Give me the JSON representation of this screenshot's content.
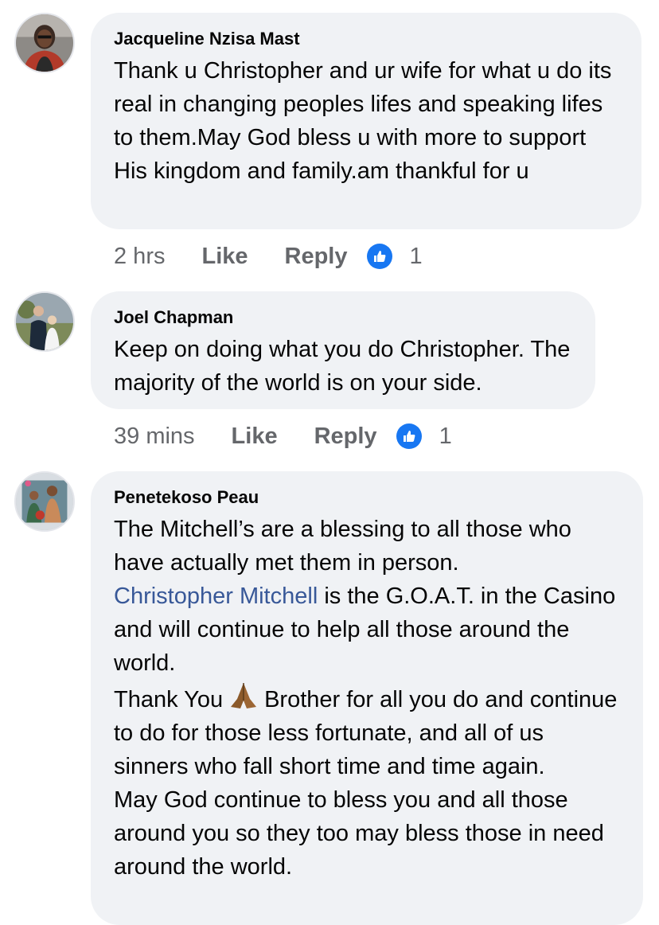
{
  "comments": [
    {
      "author": "Jacqueline Nzisa Mast",
      "text": "Thank u Christopher and ur wife for  what u do its real in changing peoples lifes and speaking lifes to them.May God bless u with more to support  His kingdom and family.am thankful for u",
      "time": "2 hrs",
      "like_label": "Like",
      "reply_label": "Reply",
      "reaction_count": "1"
    },
    {
      "author": "Joel Chapman",
      "text": "Keep on doing what you do Christopher. The majority of the world is on your side.",
      "time": "39 mins",
      "like_label": "Like",
      "reply_label": "Reply",
      "reaction_count": "1"
    },
    {
      "author": "Penetekoso Peau",
      "para1": "The Mitchell’s are a blessing to all those who have actually met them in person.",
      "mention": "Christopher Mitchell",
      "para2_rest": " is the G.O.A.T. in the Casino and will continue to help all those around the world.",
      "para3_before": "Thank You",
      "para3_emoji": "folded-hands-emoji",
      "para3_after": "Brother for all you do and continue to do for those less fortunate, and all of us sinners who fall short time and time again.",
      "para4": "May God continue to bless you and all those around you so they too may bless those in need around the world."
    }
  ],
  "colors": {
    "bubble": "#f0f2f5",
    "mention": "#385898",
    "like_badge": "#1877f2",
    "meta_text": "#65676b"
  }
}
